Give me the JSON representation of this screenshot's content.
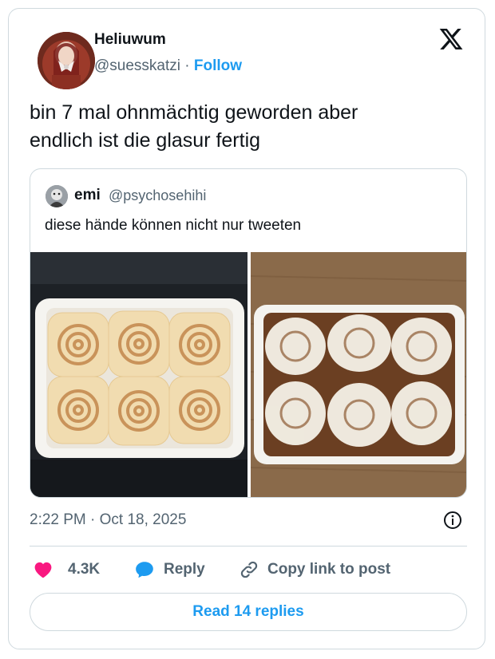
{
  "author": {
    "name": "Heliuwum",
    "handle": "@suesskatzi",
    "separator": " · ",
    "follow_label": "Follow"
  },
  "tweet": {
    "text_line1": "bin 7 mal ohnmächtig geworden aber",
    "text_line2": "endlich ist die glasur fertig"
  },
  "quoted": {
    "name": "emi",
    "handle": "@psychosehihi",
    "text": "diese hände können nicht nur tweeten"
  },
  "timestamp": "2:22 PM · Oct 18, 2025",
  "actions": {
    "likes": "4.3K",
    "reply_label": "Reply",
    "copy_label": "Copy link to post"
  },
  "read_replies_label": "Read 14 replies",
  "colors": {
    "accent": "#1d9bf0",
    "like": "#f91880",
    "secondary_text": "#536471",
    "border": "#cfd9de"
  },
  "icons": [
    "x-logo-icon",
    "heart-icon",
    "reply-bubble-icon",
    "link-icon",
    "info-icon"
  ]
}
